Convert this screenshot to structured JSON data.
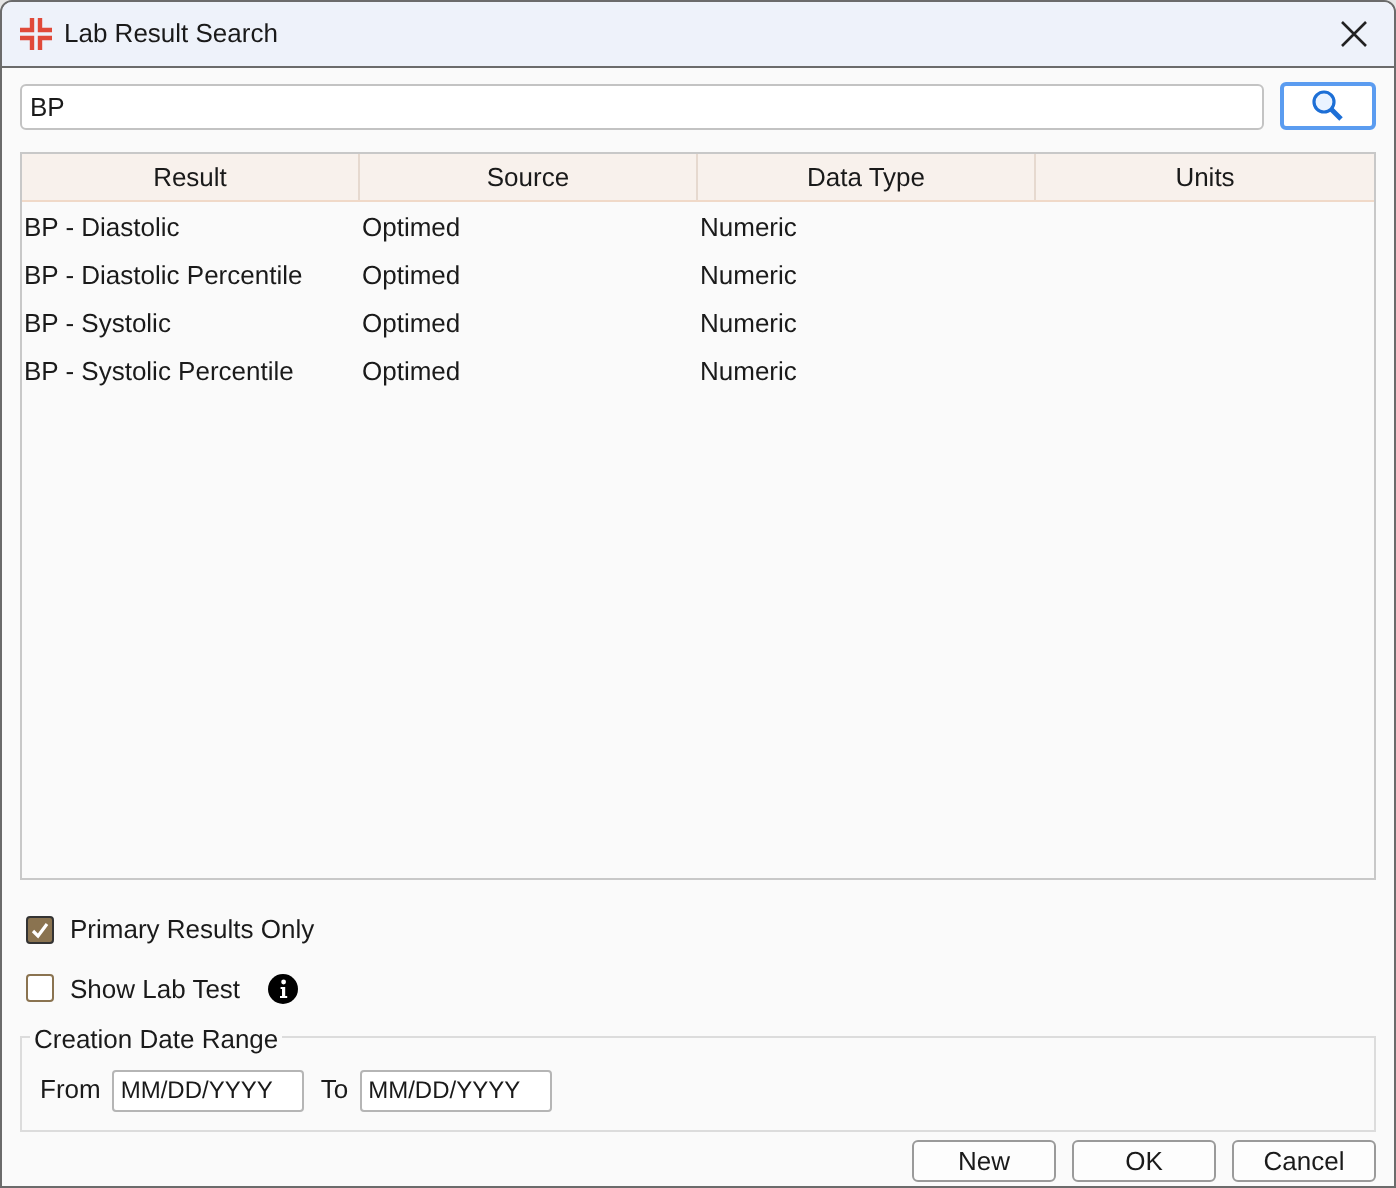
{
  "window": {
    "title": "Lab Result Search"
  },
  "search": {
    "value": "BP"
  },
  "table": {
    "columns": [
      "Result",
      "Source",
      "Data Type",
      "Units"
    ],
    "rows": [
      {
        "cells": [
          "BP - Diastolic",
          "Optimed",
          "Numeric",
          ""
        ]
      },
      {
        "cells": [
          "BP - Diastolic Percentile",
          "Optimed",
          "Numeric",
          ""
        ]
      },
      {
        "cells": [
          "BP - Systolic",
          "Optimed",
          "Numeric",
          ""
        ]
      },
      {
        "cells": [
          "BP - Systolic Percentile",
          "Optimed",
          "Numeric",
          ""
        ]
      }
    ]
  },
  "options": [
    {
      "label": "Primary Results Only",
      "checked": true,
      "info": false
    },
    {
      "label": "Show Lab Test",
      "checked": false,
      "info": true
    }
  ],
  "date_range": {
    "title": "Creation Date Range",
    "from_label": "From",
    "from": {
      "placeholder": "MM/DD/YYYY"
    },
    "to_label": "To",
    "to": {
      "placeholder": "MM/DD/YYYY"
    }
  },
  "buttons": [
    "New",
    "OK",
    "Cancel"
  ]
}
